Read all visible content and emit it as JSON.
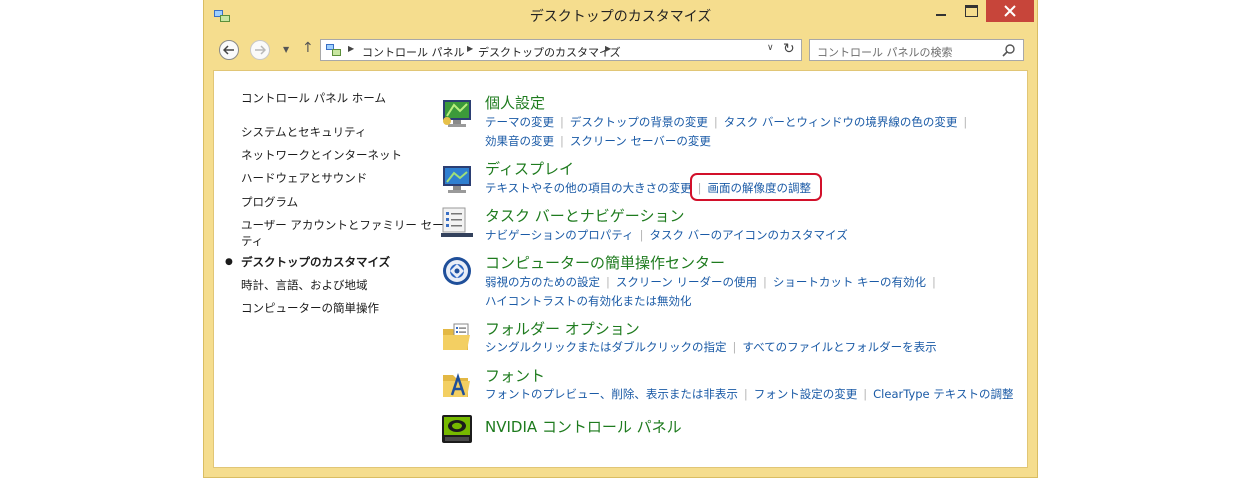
{
  "window": {
    "title": "デスクトップのカスタマイズ"
  },
  "navbar": {
    "address_segments": [
      "コントロール パネル",
      "デスクトップのカスタマイズ"
    ],
    "search_placeholder": "コントロール パネルの検索"
  },
  "sidebar": {
    "home": "コントロール パネル ホーム",
    "items": [
      "システムとセキュリティ",
      "ネットワークとインターネット",
      "ハードウェアとサウンド",
      "プログラム",
      "ユーザー アカウントとファミリー セーフ",
      "ティ",
      "デスクトップのカスタマイズ",
      "時計、言語、および地域",
      "コンピューターの簡単操作"
    ]
  },
  "categories": [
    {
      "title": "個人設定",
      "icon": "personalization-icon",
      "links": [
        [
          "テーマの変更",
          "デスクトップの背景の変更",
          "タスク バーとウィンドウの境界線の色の変更"
        ],
        [
          "効果音の変更",
          "スクリーン セーバーの変更"
        ]
      ]
    },
    {
      "title": "ディスプレイ",
      "icon": "display-icon",
      "links": [
        [
          "テキストやその他の項目の大きさの変更",
          "画面の解像度の調整"
        ]
      ]
    },
    {
      "title": "タスク バーとナビゲーション",
      "icon": "taskbar-icon",
      "links": [
        [
          "ナビゲーションのプロパティ",
          "タスク バーのアイコンのカスタマイズ"
        ]
      ]
    },
    {
      "title": "コンピューターの簡単操作センター",
      "icon": "ease-of-access-icon",
      "links": [
        [
          "弱視の方のための設定",
          "スクリーン リーダーの使用",
          "ショートカット キーの有効化"
        ],
        [
          "ハイコントラストの有効化または無効化"
        ]
      ]
    },
    {
      "title": "フォルダー オプション",
      "icon": "folder-options-icon",
      "links": [
        [
          "シングルクリックまたはダブルクリックの指定",
          "すべてのファイルとフォルダーを表示"
        ]
      ]
    },
    {
      "title": "フォント",
      "icon": "fonts-icon",
      "links": [
        [
          "フォントのプレビュー、削除、表示または非表示",
          "フォント設定の変更",
          "ClearType テキストの調整"
        ]
      ]
    },
    {
      "title": "NVIDIA コントロール パネル",
      "icon": "nvidia-icon",
      "links": []
    }
  ],
  "colors": {
    "frame": "#f5dd8e",
    "close": "#c7453a",
    "category_title": "#1e7b1e",
    "link": "#1a5aa6",
    "highlight": "#d2102a"
  }
}
